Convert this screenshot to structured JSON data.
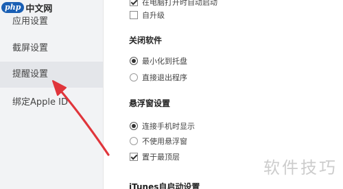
{
  "logo": {
    "badge": "php",
    "text": "中文网"
  },
  "sidebar": {
    "items": [
      {
        "label": "应用设置"
      },
      {
        "label": "截屏设置"
      },
      {
        "label": "提醒设置"
      },
      {
        "label": "绑定Apple ID"
      }
    ],
    "active_index": 2
  },
  "startup": {
    "options": [
      {
        "label": "在电脑打开时自动启动",
        "checked": true
      },
      {
        "label": "自升级",
        "checked": false
      }
    ]
  },
  "close_software": {
    "title": "关闭软件",
    "options": [
      {
        "label": "最小化到托盘",
        "selected": true
      },
      {
        "label": "直接退出程序",
        "selected": false
      }
    ]
  },
  "floating_window": {
    "title": "悬浮窗设置",
    "options": [
      {
        "label": "连接手机时显示",
        "selected": true
      },
      {
        "label": "不使用悬浮窗",
        "selected": false
      }
    ],
    "topmost": {
      "label": "置于最顶层",
      "checked": true
    }
  },
  "itunes": {
    "title": "iTunes自启动设置"
  },
  "watermark": "软件技巧",
  "colors": {
    "arrow": "#e0353b",
    "sidebar_bg": "#f2f3f5",
    "active_item_bg": "#e4e6ea"
  }
}
